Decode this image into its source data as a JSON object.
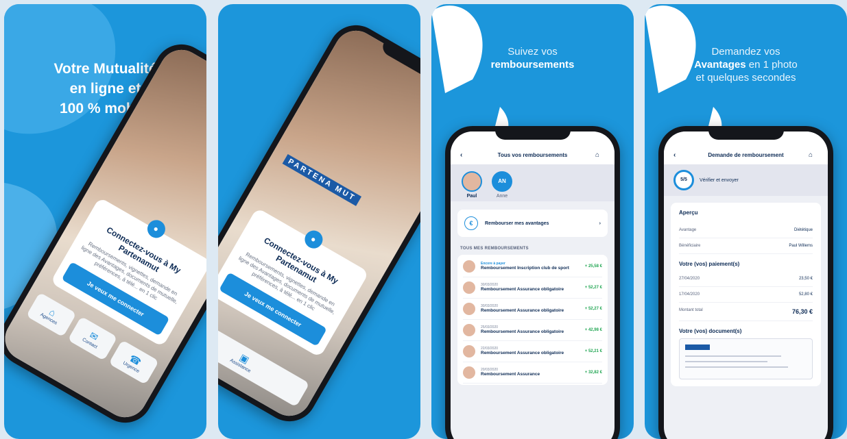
{
  "colors": {
    "brand_blue": "#1c96db",
    "button_blue": "#1c8edb",
    "navy": "#0d2b55",
    "amount_green": "#22a653"
  },
  "panel1": {
    "headline": [
      "Votre Mutualité",
      "en ligne et",
      "100 % mobile"
    ],
    "login_title": "Connectez-vous à My Partenamut",
    "login_desc": "Remboursements, vignettes, demande en ligne des Avantages, documents de mutuelle, préférences, à télé... en 1 clic",
    "login_button": "Je veux me connecter",
    "shortcuts": [
      {
        "label": "Agences",
        "icon": "building-icon"
      },
      {
        "label": "Contact",
        "icon": "chat-icon"
      },
      {
        "label": "Urgence",
        "icon": "phone-icon"
      },
      {
        "label": "Assistance",
        "icon": "card-icon"
      }
    ]
  },
  "panel2": {
    "brand": "PARTENA MUT",
    "gear": "settings-icon"
  },
  "panel3": {
    "headline_line1": "Suivez vos",
    "headline_bold": "remboursements",
    "screen_title": "Tous vos remboursements",
    "people": [
      {
        "name": "Paul",
        "initials": ""
      },
      {
        "name": "Anne",
        "initials": "AN"
      }
    ],
    "action_card": "Rembourser mes avantages",
    "section_label": "TOUS MES REMBOURSEMENTS",
    "rows": [
      {
        "date": "Encore à payer",
        "name": "Remboursement Inscription club de sport",
        "amount": "+ 25,58 €"
      },
      {
        "date": "30/03/2020",
        "name": "Remboursement Assurance obligatoire",
        "amount": "+ 52,27 €"
      },
      {
        "date": "30/03/2020",
        "name": "Remboursement Assurance obligatoire",
        "amount": "+ 52,27 €"
      },
      {
        "date": "25/03/2020",
        "name": "Remboursement Assurance obligatoire",
        "amount": "+ 42,98 €"
      },
      {
        "date": "22/03/2020",
        "name": "Remboursement Assurance obligatoire",
        "amount": "+ 52,21 €"
      },
      {
        "date": "20/03/2020",
        "name": "Remboursement Assurance",
        "amount": "+ 32,82 €"
      }
    ]
  },
  "panel4": {
    "headline_line1": "Demandez vos",
    "headline_bold": "Avantages",
    "headline_rest": " en 1 photo",
    "headline_line3": "et quelques secondes",
    "screen_title": "Demande de remboursement",
    "step": "5/5",
    "step_label": "Vérifier et envoyer",
    "card_title": "Aperçu",
    "kv": [
      {
        "k": "Avantage",
        "v": "Diététique"
      },
      {
        "k": "Bénéficiaire",
        "v": "Paul Willems"
      }
    ],
    "payments_title": "Votre (vos) paiement(s)",
    "payments": [
      {
        "k": "27/04/2020",
        "v": "23,50 €"
      },
      {
        "k": "17/04/2020",
        "v": "52,80 €"
      }
    ],
    "total_label": "Montant total",
    "total_value": "76,30 €",
    "docs_title": "Votre (vos) document(s)"
  }
}
